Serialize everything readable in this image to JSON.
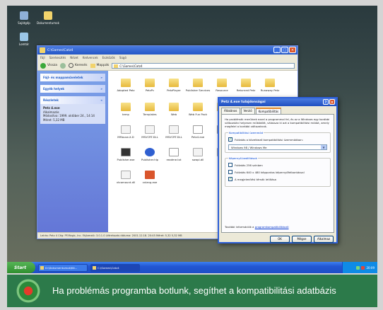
{
  "desktop": {
    "icons": [
      {
        "label": "Sajátgép"
      },
      {
        "label": "Dokumentumok"
      },
      {
        "label": "Lomtár"
      }
    ]
  },
  "explorer": {
    "title": "C:\\Games\\Catz4",
    "menu": [
      "Fájl",
      "Szerkesztés",
      "Nézet",
      "Kedvencek",
      "Eszközök",
      "Súgó"
    ],
    "toolbar": {
      "back": "Vissza",
      "search": "Keresés",
      "folders": "Mappák"
    },
    "address": "C:\\Games\\Catz4",
    "left_panels": [
      {
        "title": "Fájl- és mappaműveletek"
      },
      {
        "title": "Egyéb helyek"
      },
      {
        "title": "Részletek",
        "details": [
          "Petz 4.exe",
          "Alkalmazás",
          "Módosítva: 1999. október 24., 14:14",
          "Méret: 5,32 MB"
        ]
      }
    ],
    "files": [
      "Adopted Petz",
      "PetzPc",
      "PetzPlayer",
      "Publisher Services",
      "Resource",
      "Returned Petz",
      "Runaway Petz",
      "temp",
      "Templates",
      "Web",
      "Web Fun Pack",
      "Wrap",
      "MMouse-X-D",
      "MSVCRT.DLL",
      "MSVCRT.DLL",
      "Petz4.exe",
      "PF",
      "Publisher.exe",
      "Publisher.hlp",
      "readme.txt",
      "swapi.dll",
      "Uni",
      "vtcomount.dll",
      "vxlang.exe"
    ],
    "status": "Leírás: Petz 4 Cég: PF.Magic, Inc. Fájlverzió: 3.0.1.0 Létrehozás dátuma: 2001.12.18. 20:45 Méret: 5,32 5,32 MB"
  },
  "dialog": {
    "title": "Petz 4.exe tulajdonságai",
    "tabs": [
      "Általános",
      "Verzió",
      "Kompatibilitás"
    ],
    "intro": "Ha problémák merülnek ezzel a programmal fel, és az a Windows egy korábbi változatán helyesen működött, válassza ki azt a kompatibilitási módot, amely megfelel a korábbi változatnak.",
    "compat_group": "Kompatibilitási üzemmód",
    "compat_check": "Futtatás a következő kompatibilitási üzemmódban:",
    "compat_select": "Windows 98 / Windows Me",
    "display_group": "Képernyő-beállítások",
    "display_options": [
      {
        "label": "Futtatás 256 színben",
        "checked": false
      },
      {
        "label": "Futtatás 640 x 480 képpontos képernyőfelbontással",
        "checked": false
      },
      {
        "label": "A megjelenítési témák letiltása",
        "checked": true
      }
    ],
    "more_info": "További információk a",
    "more_link": "programkompatibilitásról",
    "buttons": {
      "ok": "OK",
      "cancel": "Mégse",
      "apply": "Alkalmaz"
    }
  },
  "taskbar": {
    "start": "Start",
    "tasks": [
      "D:\\Dokumentumok\\Kö...",
      "C:\\Games\\Catz4"
    ],
    "clock": "20:09"
  },
  "caption": {
    "text": "Ha problémás programba botlunk, segíthet a kompatibilitási adatbázis"
  }
}
